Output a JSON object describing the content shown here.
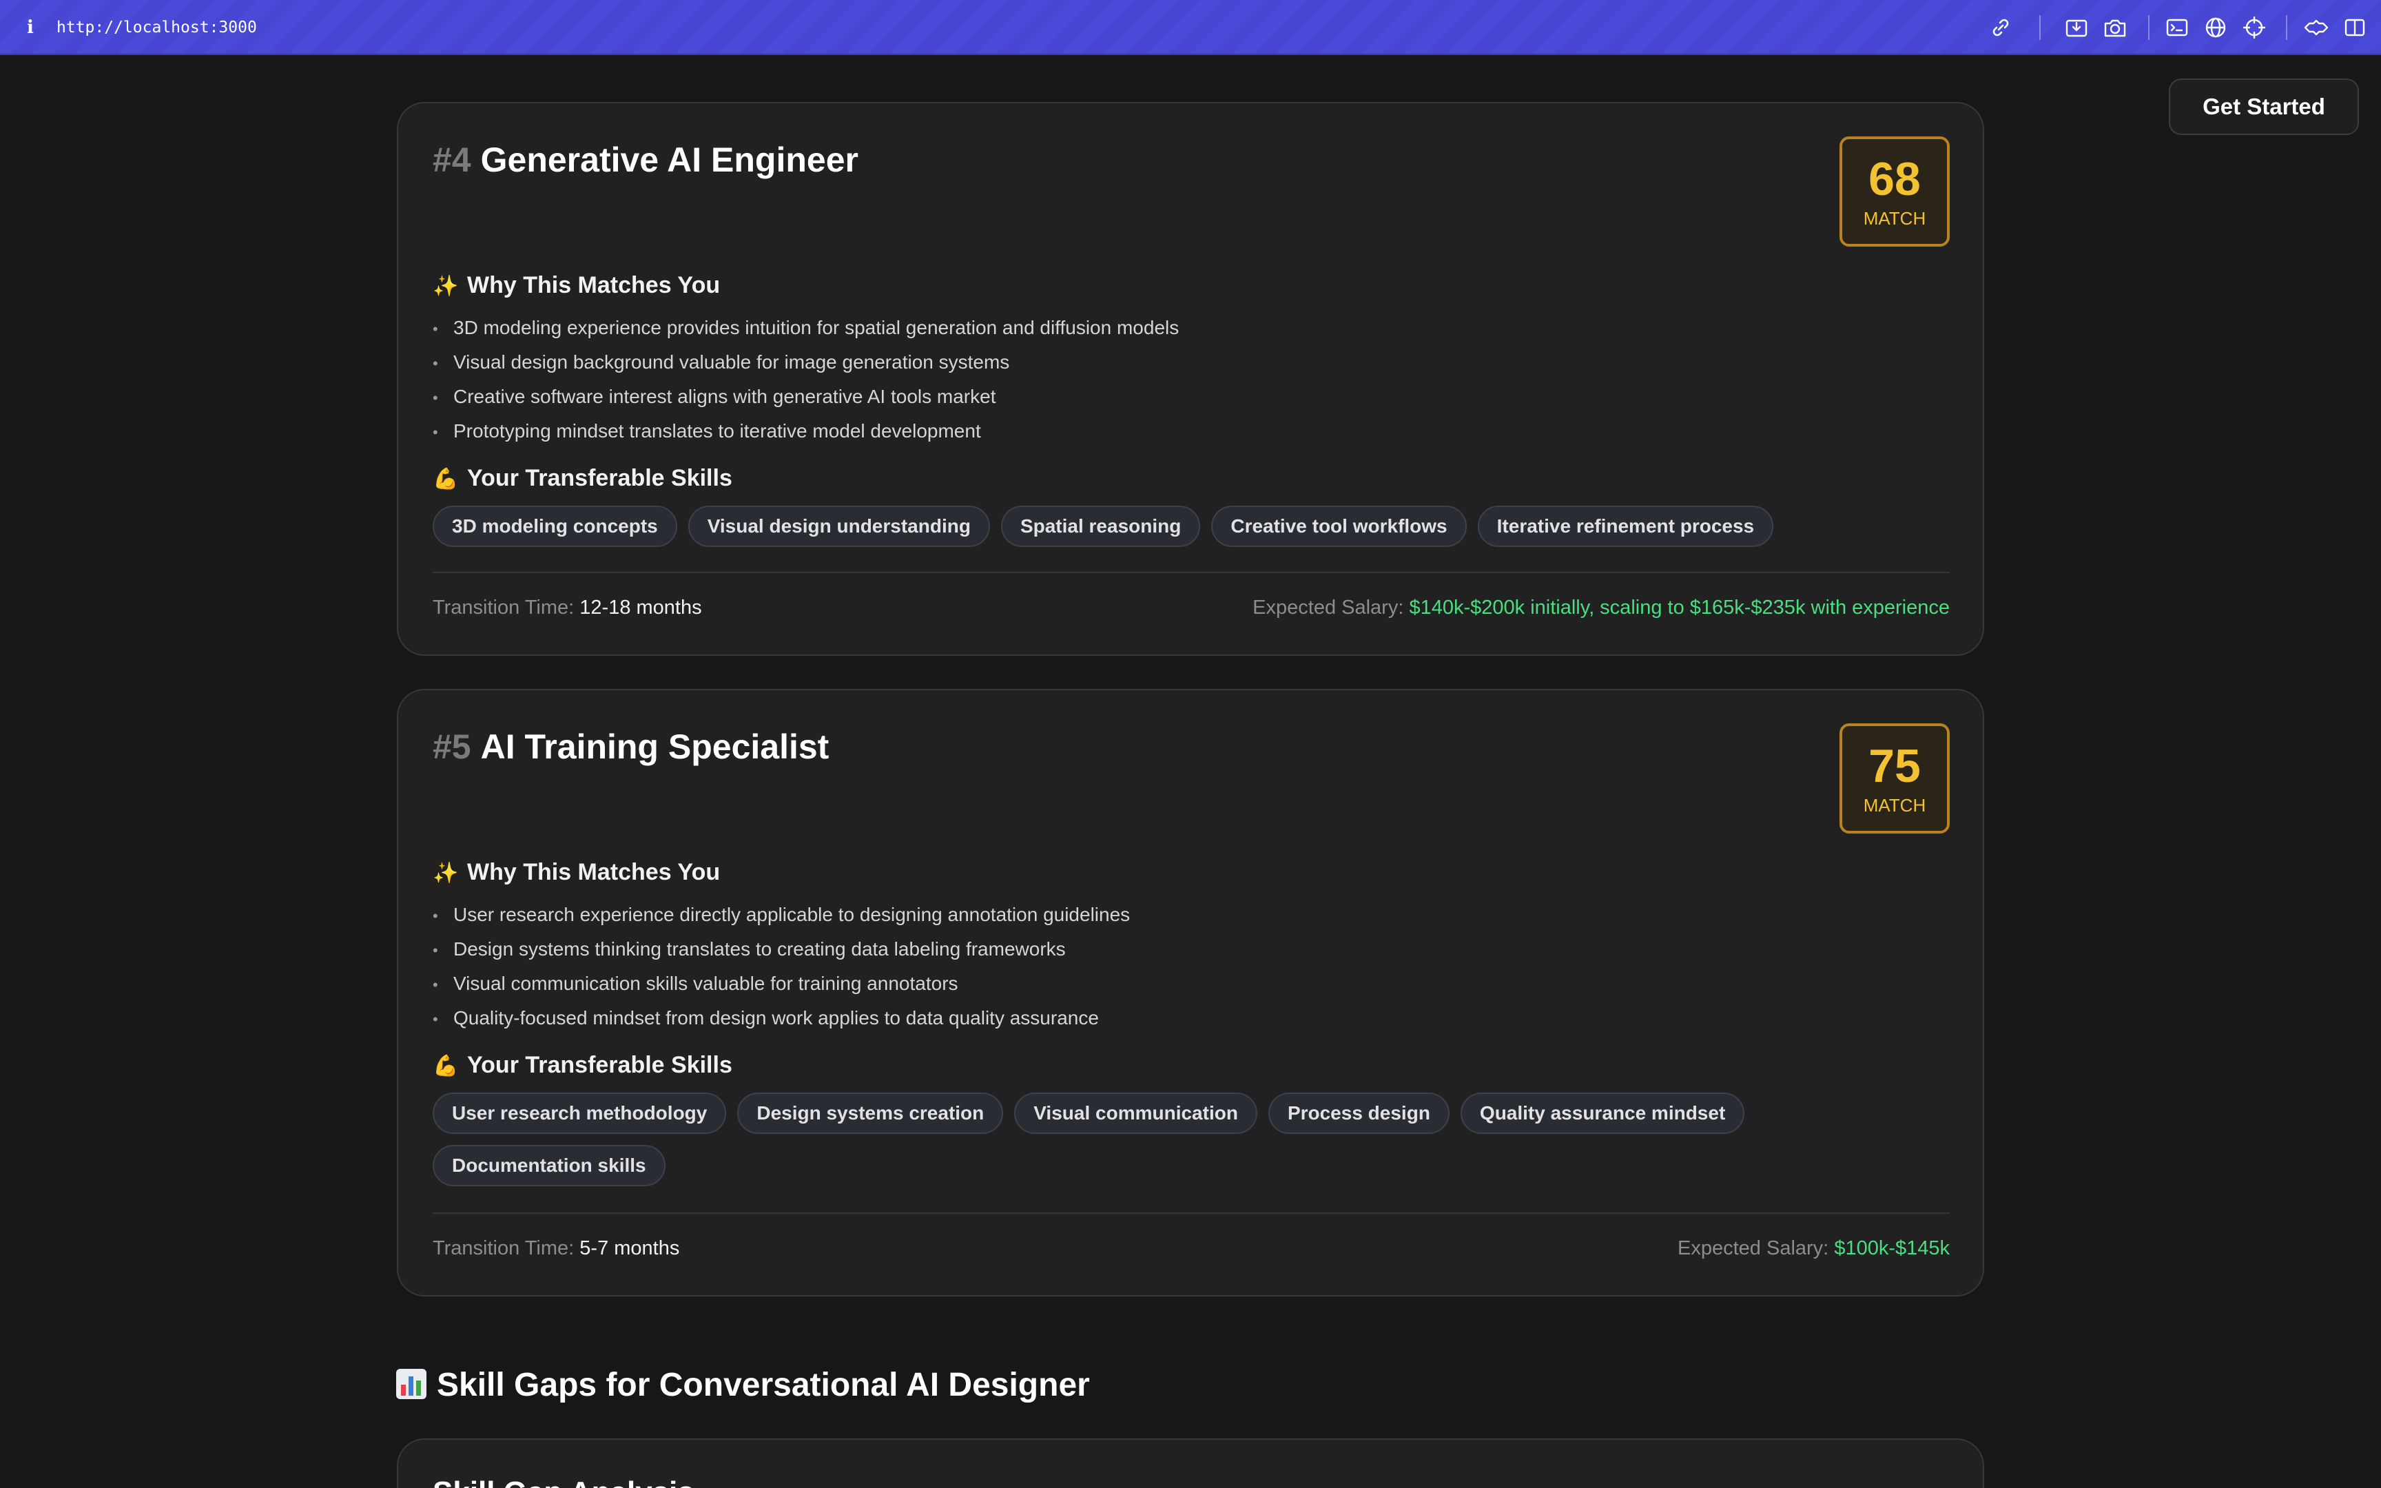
{
  "browser": {
    "info_icon": "i",
    "url": "http://localhost:3000",
    "icons": [
      "link-icon",
      "download-icon",
      "camera-icon",
      "terminal-icon",
      "globe-icon",
      "crosshair-icon",
      "extensions-icon",
      "sidebar-icon"
    ]
  },
  "header": {
    "cta_label": "Get Started"
  },
  "careers": [
    {
      "rank": "#4",
      "title": "Generative AI Engineer",
      "score": "68",
      "score_label": "MATCH",
      "why_heading": "Why This Matches You",
      "why_icon": "✨",
      "reasons": [
        "3D modeling experience provides intuition for spatial generation and diffusion models",
        "Visual design background valuable for image generation systems",
        "Creative software interest aligns with generative AI tools market",
        "Prototyping mindset translates to iterative model development"
      ],
      "skills_heading": "Your Transferable Skills",
      "skills_icon": "💪",
      "skills": [
        "3D modeling concepts",
        "Visual design understanding",
        "Spatial reasoning",
        "Creative tool workflows",
        "Iterative refinement process"
      ],
      "transition_label": "Transition Time:",
      "transition_value": "12-18 months",
      "salary_label": "Expected Salary:",
      "salary_value": "$140k-$200k initially, scaling to $165k-$235k with experience"
    },
    {
      "rank": "#5",
      "title": "AI Training Specialist",
      "score": "75",
      "score_label": "MATCH",
      "why_heading": "Why This Matches You",
      "why_icon": "✨",
      "reasons": [
        "User research experience directly applicable to designing annotation guidelines",
        "Design systems thinking translates to creating data labeling frameworks",
        "Visual communication skills valuable for training annotators",
        "Quality-focused mindset from design work applies to data quality assurance"
      ],
      "skills_heading": "Your Transferable Skills",
      "skills_icon": "💪",
      "skills": [
        "User research methodology",
        "Design systems creation",
        "Visual communication",
        "Process design",
        "Quality assurance mindset",
        "Documentation skills"
      ],
      "transition_label": "Transition Time:",
      "transition_value": "5-7 months",
      "salary_label": "Expected Salary:",
      "salary_value": "$100k-$145k"
    }
  ],
  "skill_gaps": {
    "icon": "bar-chart-icon",
    "title": "Skill Gaps for Conversational AI Designer",
    "card_title": "Skill Gap Analysis"
  },
  "colors": {
    "accent_gold": "#f3c232",
    "salary_green": "#4ade80",
    "browser_bar": "#4a4ad8"
  }
}
